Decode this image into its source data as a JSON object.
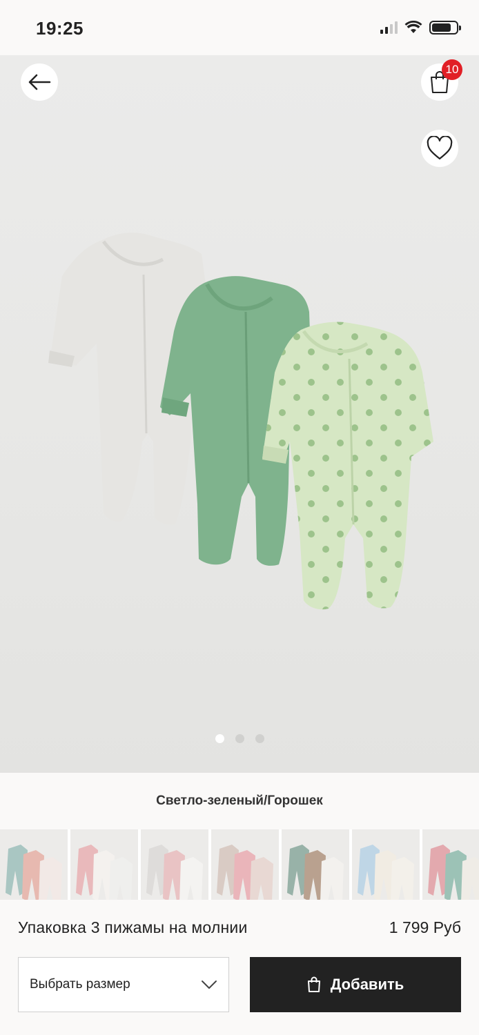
{
  "status": {
    "time": "19:25",
    "battery_level": 0.8
  },
  "header": {
    "cart_count": "10"
  },
  "gallery": {
    "pages": 3,
    "active_page": 1
  },
  "product": {
    "color_name": "Светло-зеленый/Горошек",
    "title": "Упаковка 3 пижамы на молнии",
    "price": "1 799 Руб"
  },
  "swatches": [
    {
      "name": "mint-floral-rose",
      "colors": [
        "#a9c6c2",
        "#e7b9b0",
        "#f2e9e6"
      ]
    },
    {
      "name": "pink-white-print",
      "colors": [
        "#e9b9bb",
        "#f4f1ee",
        "#efefed"
      ]
    },
    {
      "name": "grey-pink-white",
      "colors": [
        "#dedcda",
        "#e9c3c4",
        "#f4f3f1"
      ]
    },
    {
      "name": "beige-pink-print",
      "colors": [
        "#d9cbc4",
        "#eab5ba",
        "#e8d8d3"
      ]
    },
    {
      "name": "sage-brown-white",
      "colors": [
        "#98b2a8",
        "#b9a18f",
        "#f3f1ee"
      ]
    },
    {
      "name": "blue-cream-print",
      "colors": [
        "#bfd6e6",
        "#f1ece3",
        "#f3f0ea"
      ]
    },
    {
      "name": "pink-mint-white",
      "colors": [
        "#e3a9ae",
        "#9cc2b6",
        "#efece6"
      ]
    }
  ],
  "actions": {
    "size_placeholder": "Выбрать размер",
    "add_label": "Добавить"
  },
  "colors": {
    "badge": "#e11f26",
    "button_dark": "#222222",
    "sage": "#7cb48b",
    "light_green": "#d4e6c3"
  }
}
